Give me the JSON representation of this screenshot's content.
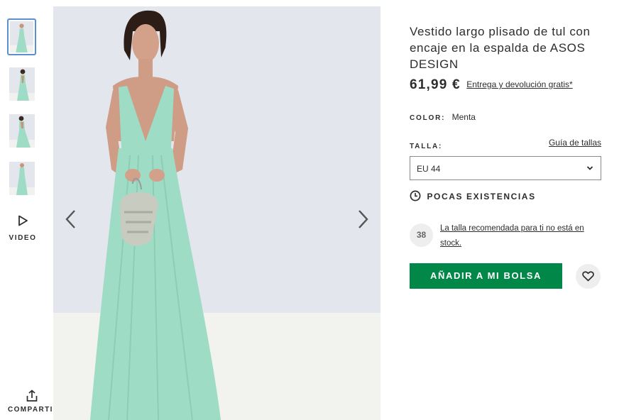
{
  "thumbnails": [
    {
      "label": "Vista frontal",
      "selected": true
    },
    {
      "label": "Vista espalda",
      "selected": false
    },
    {
      "label": "Vista lateral",
      "selected": false
    },
    {
      "label": "Vista completa",
      "selected": false
    }
  ],
  "media": {
    "video_label": "VIDEO",
    "share_label": "COMPARTIR"
  },
  "product": {
    "title": "Vestido largo plisado de tul con encaje en la espalda de ASOS DESIGN",
    "price": "61,99 €",
    "delivery_link": "Entrega y devolución gratis*",
    "color_label": "COLOR:",
    "color_value": "Menta",
    "size_label": "TALLA:",
    "size_guide_link": "Guía de tallas",
    "size_selected": "EU 44",
    "stock_status": "POCAS EXISTENCIAS",
    "recommended_size": "38",
    "recommended_text": "La talla recomendada para ti no está en stock.",
    "add_to_bag": "AÑADIR A MI BOLSA"
  },
  "icons": {
    "play": "play-icon",
    "share": "share-icon",
    "prev": "chevron-left-icon",
    "next": "chevron-right-icon",
    "dropdown": "chevron-down-icon",
    "clock": "clock-icon",
    "heart": "heart-icon"
  },
  "colors": {
    "add_button": "#018849",
    "dress": "#9fdcc6",
    "photo_background": "#e4e6ee",
    "thumbnail_selected_border": "#5a8fd6"
  }
}
